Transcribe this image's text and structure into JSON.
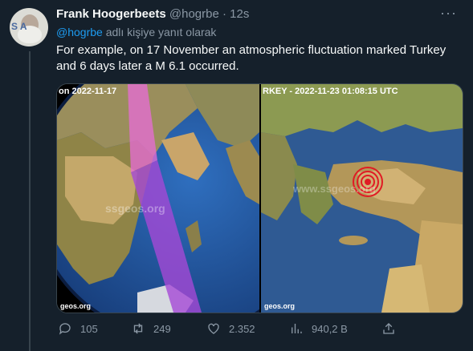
{
  "tweet": {
    "author_name": "Frank Hoogerbeets",
    "handle": "@hogrbe",
    "separator": "·",
    "time": "12s",
    "reply_mention": "@hogrbe",
    "reply_suffix": " adlı kişiye yanıt olarak",
    "text": "For example, on 17 November an atmospheric fluctuation marked Turkey and 6 days later a M 6.1 occurred.",
    "avatar_label": "S A"
  },
  "media": {
    "left_caption": "on 2022-11-17",
    "left_watermark": "ssgeos.org",
    "left_footer": "geos.org",
    "right_caption": "RKEY - 2022-11-23 01:08:15 UTC",
    "right_watermark": "www.ssgeos.org",
    "right_footer": "geos.org"
  },
  "actions": {
    "replies": "105",
    "retweets": "249",
    "likes": "2.352",
    "views": "940,2 B"
  },
  "icons": [
    "more-icon",
    "reply-icon",
    "retweet-icon",
    "like-icon",
    "views-icon",
    "share-icon"
  ],
  "colors": {
    "background": "#15202b",
    "accent": "#1d9bf0",
    "muted": "#8b98a5",
    "text": "#f7f9f9"
  }
}
